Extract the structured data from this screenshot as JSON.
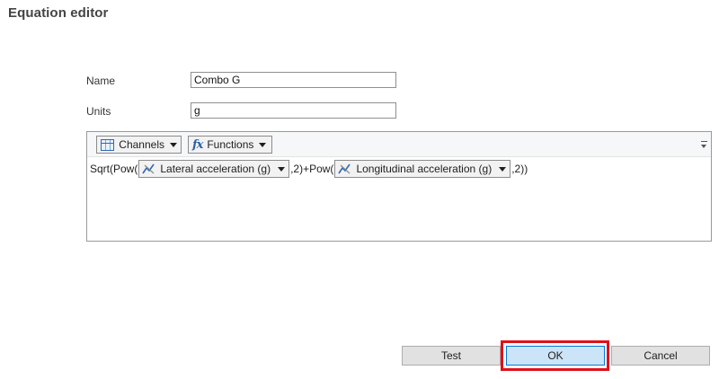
{
  "window": {
    "title": "Equation editor"
  },
  "form": {
    "name_label": "Name",
    "name_value": "Combo G",
    "units_label": "Units",
    "units_value": "g"
  },
  "editor": {
    "toolbar": {
      "channels_label": "Channels",
      "functions_label": "Functions",
      "channels_icon": "grid-icon",
      "functions_icon": "fx-icon"
    },
    "equation": {
      "part1": "Sqrt(Pow(",
      "channel1": "Lateral acceleration (g)",
      "part2": ",2)+Pow(",
      "channel2": "Longitudinal acceleration (g)",
      "part3": ",2))",
      "channel_icon": "channel-icon"
    }
  },
  "buttons": {
    "test_label": "Test",
    "ok_label": "OK",
    "cancel_label": "Cancel"
  },
  "colors": {
    "highlight": "#e0101a",
    "primary_button": "#cce4f7",
    "primary_border": "#0078d7"
  }
}
